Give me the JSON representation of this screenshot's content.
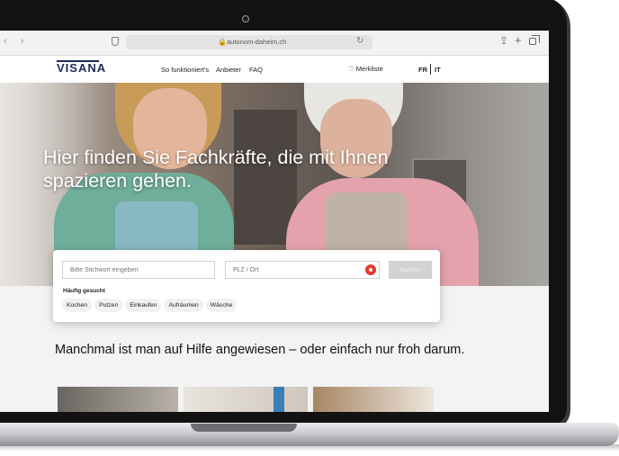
{
  "browser": {
    "url": "autonom-daheim.ch",
    "nav_arrows": "‹ ›",
    "lock_glyph": "🔒",
    "reload_glyph": "↻",
    "share_glyph": "⇪",
    "plus_glyph": "+",
    "icons": [
      "back-icon",
      "forward-icon",
      "shield-icon",
      "lock-icon",
      "reload-icon",
      "share-icon",
      "new-tab-icon",
      "tabs-overview-icon"
    ]
  },
  "site": {
    "logo": "VISANA",
    "nav": {
      "how_it_works": "So funktioniert's",
      "providers": "Anbieter",
      "faq": "FAQ"
    },
    "watchlist": "♡ Merkliste",
    "lang_fr": "FR",
    "lang_it": "IT"
  },
  "hero": {
    "title": "Hier finden Sie Fachkräfte, die mit Ihnen spazieren gehen."
  },
  "search": {
    "keyword_placeholder": "Bitte Stichwort eingeben",
    "location_placeholder": "PLZ / Ort",
    "button": "Suchen",
    "frequent_label": "Häufig gesucht",
    "chips": [
      "Kochen",
      "Putzen",
      "Einkaufen",
      "Aufräumen",
      "Wäsche"
    ]
  },
  "section": {
    "title": "Manchmal ist man auf Hilfe angewiesen – oder einfach nur froh darum."
  },
  "colors": {
    "brand_navy": "#1c2a5a",
    "locate_red": "#e23b2e",
    "button_disabled": "#d2d2d2"
  }
}
